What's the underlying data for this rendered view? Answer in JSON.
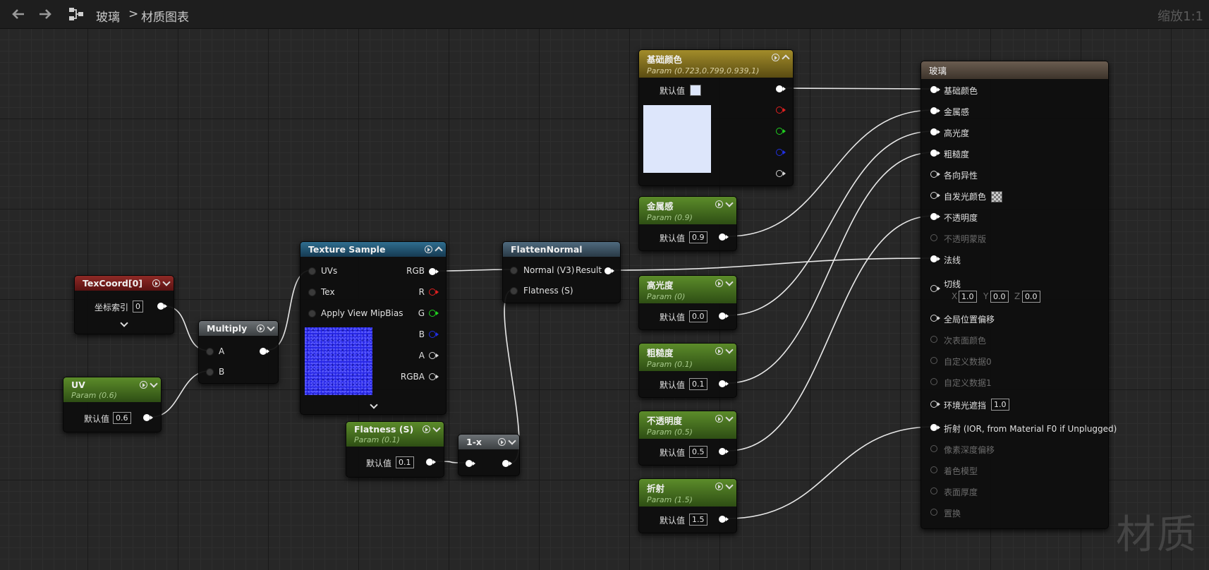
{
  "toolbar": {
    "back_icon": "arrow-left-icon",
    "forward_icon": "arrow-right-icon",
    "graph_icon": "material-graph-icon",
    "breadcrumb_root": "玻璃",
    "breadcrumb_sep": ">",
    "breadcrumb_current": "材质图表",
    "zoom": "缩放1:1"
  },
  "watermark": "材质",
  "default_label": "默认值",
  "texcoord": {
    "title": "TexCoord[0]",
    "index_label": "坐标索引",
    "index_value": "0"
  },
  "uv": {
    "title": "UV",
    "subtitle": "Param (0.6)",
    "value": "0.6"
  },
  "multiply": {
    "title": "Multiply",
    "input_a": "A",
    "input_b": "B"
  },
  "texture_sample": {
    "title": "Texture Sample",
    "inputs": [
      "UVs",
      "Tex",
      "Apply View MipBias"
    ],
    "outputs": [
      "RGB",
      "R",
      "G",
      "B",
      "A",
      "RGBA"
    ]
  },
  "flatten_normal": {
    "title": "FlattenNormal",
    "input_normal": "Normal (V3)",
    "input_flatness": "Flatness (S)",
    "output": "Result"
  },
  "flatness_param": {
    "title": "Flatness (S)",
    "subtitle": "Param (0.1)",
    "value": "0.1"
  },
  "one_minus": {
    "title": "1-x"
  },
  "base_color_param": {
    "title": "基础颜色",
    "subtitle": "Param (0.723,0.799,0.939,1)",
    "color": "#dde6fb"
  },
  "metallic_param": {
    "title": "金属感",
    "subtitle": "Param (0.9)",
    "value": "0.9"
  },
  "specular_param": {
    "title": "高光度",
    "subtitle": "Param (0)",
    "value": "0.0"
  },
  "roughness_param": {
    "title": "粗糙度",
    "subtitle": "Param (0.1)",
    "value": "0.1"
  },
  "opacity_param": {
    "title": "不透明度",
    "subtitle": "Param (0.5)",
    "value": "0.5"
  },
  "refraction_param": {
    "title": "折射",
    "subtitle": "Param (1.5)",
    "value": "1.5"
  },
  "result_node": {
    "title": "玻璃",
    "pins": {
      "base_color": "基础颜色",
      "metallic": "金属感",
      "specular": "高光度",
      "roughness": "粗糙度",
      "anisotropy": "各向异性",
      "emissive": "自发光颜色",
      "opacity": "不透明度",
      "opacity_mask": "不透明蒙版",
      "normal": "法线",
      "tangent": "切线",
      "tangent_x_label": "X",
      "tangent_x": "1.0",
      "tangent_y_label": "Y",
      "tangent_y": "0.0",
      "tangent_z_label": "Z",
      "tangent_z": "0.0",
      "world_offset": "全局位置偏移",
      "subsurface": "次表面颜色",
      "custom0": "自定义数据0",
      "custom1": "自定义数据1",
      "ao": "环境光遮挡",
      "ao_value": "1.0",
      "refraction": "折射 (IOR, from Material F0 if Unplugged)",
      "pixel_depth": "像素深度偏移",
      "shading_model": "着色模型",
      "thickness": "表面厚度",
      "displacement": "置换"
    }
  },
  "colors": {
    "wire": "#e8e8e8",
    "red_pin": "#e02020",
    "green_pin": "#20d020",
    "blue_pin": "#2030e0"
  }
}
